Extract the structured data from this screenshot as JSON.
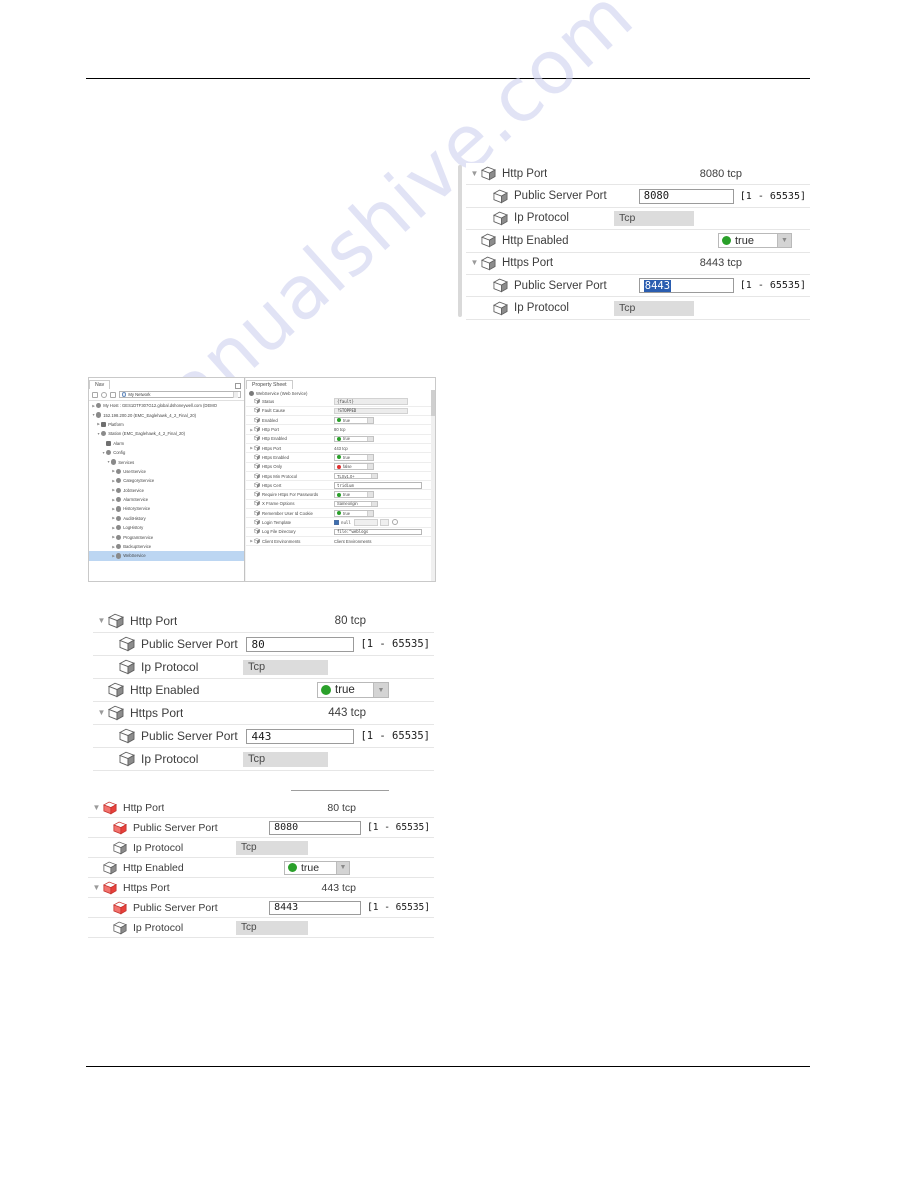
{
  "document": {
    "watermark": "manualshive.com",
    "header_rule": true,
    "footer_rule": true
  },
  "panel_top": {
    "name": "http-https-port-expanded-8080-8443",
    "rows": [
      {
        "twisty": "open",
        "indent": 0,
        "icon": "cube-icon",
        "icon_color": "#8c8c8c",
        "label": "Http Port",
        "value_type": "text",
        "value": "8080 tcp"
      },
      {
        "twisty": "blank",
        "indent": 1,
        "icon": "cube-icon",
        "icon_color": "#8c8c8c",
        "label": "Public Server Port",
        "value_type": "field",
        "value": "8080",
        "range": "[1 - 65535]",
        "selected": false
      },
      {
        "twisty": "blank",
        "indent": 1,
        "icon": "cube-icon",
        "icon_color": "#8c8c8c",
        "label": "Ip Protocol",
        "value_type": "disabled",
        "value": "Tcp"
      },
      {
        "twisty": "blank",
        "indent": 0,
        "icon": "cube-icon",
        "icon_color": "#8c8c8c",
        "label": "Http Enabled",
        "value_type": "combo",
        "value": "true",
        "dot": "green"
      },
      {
        "twisty": "open",
        "indent": 0,
        "icon": "cube-icon",
        "icon_color": "#8c8c8c",
        "label": "Https Port",
        "value_type": "text",
        "value": "8443 tcp"
      },
      {
        "twisty": "blank",
        "indent": 1,
        "icon": "cube-icon",
        "icon_color": "#8c8c8c",
        "label": "Public Server Port",
        "value_type": "field",
        "value": "8443",
        "range": "[1 - 65535]",
        "selected": true
      },
      {
        "twisty": "blank",
        "indent": 1,
        "icon": "cube-icon",
        "icon_color": "#8c8c8c",
        "label": "Ip Protocol",
        "value_type": "disabled",
        "value": "Tcp"
      }
    ]
  },
  "panel_workbench": {
    "nav": {
      "tab_label": "Nav",
      "address_value": "My Network",
      "address_icon": "globe-icon",
      "toolbar_icons": [
        "bookmark-icon",
        "refresh-icon",
        "stop-icon"
      ],
      "tree": [
        {
          "indent": 0,
          "twisty": "closed",
          "icon": "host-icon",
          "label": "My Host : GES1DTF307G12.global.dshoneywell.com (DEMO"
        },
        {
          "indent": 0,
          "twisty": "open",
          "icon": "station-icon",
          "label": "152.198.200.20 (EMC_Eaglehawk_4_2_Final_20)"
        },
        {
          "indent": 1,
          "twisty": "closed",
          "icon": "platform-icon",
          "label": "Platform"
        },
        {
          "indent": 1,
          "twisty": "open",
          "icon": "station-icon",
          "label": "Station (EMC_Eaglehawk_4_2_Final_20)"
        },
        {
          "indent": 2,
          "twisty": "blank",
          "icon": "alarm-icon",
          "label": "Alarm"
        },
        {
          "indent": 2,
          "twisty": "open",
          "icon": "config-icon",
          "label": "Config"
        },
        {
          "indent": 3,
          "twisty": "open",
          "icon": "services-icon",
          "label": "Services"
        },
        {
          "indent": 4,
          "twisty": "closed",
          "icon": "service-icon",
          "label": "UserService"
        },
        {
          "indent": 4,
          "twisty": "closed",
          "icon": "service-icon",
          "label": "CategoryService"
        },
        {
          "indent": 4,
          "twisty": "closed",
          "icon": "service-icon",
          "label": "JobService"
        },
        {
          "indent": 4,
          "twisty": "closed",
          "icon": "service-icon",
          "label": "AlarmService"
        },
        {
          "indent": 4,
          "twisty": "closed",
          "icon": "service-icon",
          "label": "HistoryService"
        },
        {
          "indent": 4,
          "twisty": "closed",
          "icon": "service-icon",
          "label": "AuditHistory"
        },
        {
          "indent": 4,
          "twisty": "closed",
          "icon": "service-icon",
          "label": "LogHistory"
        },
        {
          "indent": 4,
          "twisty": "closed",
          "icon": "service-icon",
          "label": "ProgramService"
        },
        {
          "indent": 4,
          "twisty": "closed",
          "icon": "service-icon",
          "label": "BackupService"
        },
        {
          "indent": 4,
          "twisty": "closed",
          "icon": "service-icon",
          "label": "WebService",
          "selected": true
        }
      ]
    },
    "property_sheet": {
      "tab_label": "Property Sheet",
      "object_title": "WebService  (Web Service)",
      "rows": [
        {
          "twisty": "blank",
          "label": "Status",
          "kind": "field",
          "value": "{fault}"
        },
        {
          "twisty": "blank",
          "label": "Fault Cause",
          "kind": "field",
          "value": "!STOPPED"
        },
        {
          "twisty": "blank",
          "label": "Enabled",
          "kind": "combo",
          "value": "true",
          "dot": "green"
        },
        {
          "twisty": "closed",
          "label": "Http Port",
          "kind": "text",
          "value": "80 tcp"
        },
        {
          "twisty": "blank",
          "label": "Http Enabled",
          "kind": "combo",
          "value": "true",
          "dot": "green"
        },
        {
          "twisty": "closed",
          "label": "Https Port",
          "kind": "text",
          "value": "443 tcp"
        },
        {
          "twisty": "blank",
          "label": "Https Enabled",
          "kind": "combo",
          "value": "true",
          "dot": "green"
        },
        {
          "twisty": "blank",
          "label": "Https Only",
          "kind": "combo",
          "value": "false",
          "dot": "red"
        },
        {
          "twisty": "blank",
          "label": "Https Min Protocol",
          "kind": "combo2",
          "value": "TLSv1.0+"
        },
        {
          "twisty": "blank",
          "label": "Https Cert",
          "kind": "fieldw",
          "value": "tridium"
        },
        {
          "twisty": "blank",
          "label": "Require Https For Passwords",
          "kind": "combo",
          "value": "true",
          "dot": "green"
        },
        {
          "twisty": "blank",
          "label": "X Frame Options",
          "kind": "combo2",
          "value": "Sameorigin"
        },
        {
          "twisty": "blank",
          "label": "Remember User Id Cookie",
          "kind": "combo",
          "value": "true",
          "dot": "green"
        },
        {
          "twisty": "blank",
          "label": "Login Template",
          "kind": "nullrow",
          "value": "null"
        },
        {
          "twisty": "blank",
          "label": "Log File Directory",
          "kind": "fieldw",
          "value": "file:^weblogs"
        },
        {
          "twisty": "closed",
          "label": "Client Environments",
          "kind": "text",
          "value": "Client Environments"
        }
      ]
    }
  },
  "panel_middle": {
    "name": "http-https-port-expanded-80-443",
    "rows": [
      {
        "twisty": "open",
        "indent": 0,
        "icon": "cube-icon",
        "icon_color": "#8c8c8c",
        "label": "Http Port",
        "value_type": "text",
        "value": "80 tcp"
      },
      {
        "twisty": "blank",
        "indent": 1,
        "icon": "cube-icon",
        "icon_color": "#8c8c8c",
        "label": "Public Server Port",
        "value_type": "field",
        "value": "80",
        "range": "[1 - 65535]"
      },
      {
        "twisty": "blank",
        "indent": 1,
        "icon": "cube-icon",
        "icon_color": "#8c8c8c",
        "label": "Ip Protocol",
        "value_type": "disabled",
        "value": "Tcp"
      },
      {
        "twisty": "blank",
        "indent": 0,
        "icon": "cube-icon",
        "icon_color": "#8c8c8c",
        "label": "Http Enabled",
        "value_type": "combo",
        "value": "true",
        "dot": "green"
      },
      {
        "twisty": "open",
        "indent": 0,
        "icon": "cube-icon",
        "icon_color": "#8c8c8c",
        "label": "Https Port",
        "value_type": "text",
        "value": "443 tcp"
      },
      {
        "twisty": "blank",
        "indent": 1,
        "icon": "cube-icon",
        "icon_color": "#8c8c8c",
        "label": "Public Server Port",
        "value_type": "field",
        "value": "443",
        "range": "[1 - 65535]"
      },
      {
        "twisty": "blank",
        "indent": 1,
        "icon": "cube-icon",
        "icon_color": "#8c8c8c",
        "label": "Ip Protocol",
        "value_type": "disabled",
        "value": "Tcp"
      }
    ]
  },
  "panel_bottom": {
    "name": "http-https-port-modified-8080-8443",
    "rows": [
      {
        "twisty": "open",
        "indent": 0,
        "icon": "cube-icon",
        "icon_color": "#e8413c",
        "label": "Http Port",
        "value_type": "text",
        "value": "80 tcp"
      },
      {
        "twisty": "blank",
        "indent": 1,
        "icon": "cube-icon",
        "icon_color": "#e8413c",
        "label": "Public Server Port",
        "value_type": "field",
        "value": "8080",
        "range": "[1 - 65535]"
      },
      {
        "twisty": "blank",
        "indent": 1,
        "icon": "cube-icon",
        "icon_color": "#8c8c8c",
        "label": "Ip Protocol",
        "value_type": "disabled",
        "value": "Tcp"
      },
      {
        "twisty": "blank",
        "indent": 0,
        "icon": "cube-icon",
        "icon_color": "#8c8c8c",
        "label": "Http Enabled",
        "value_type": "combo",
        "value": "true",
        "dot": "green"
      },
      {
        "twisty": "open",
        "indent": 0,
        "icon": "cube-icon",
        "icon_color": "#e8413c",
        "label": "Https Port",
        "value_type": "text",
        "value": "443 tcp"
      },
      {
        "twisty": "blank",
        "indent": 1,
        "icon": "cube-icon",
        "icon_color": "#e8413c",
        "label": "Public Server Port",
        "value_type": "field",
        "value": "8443",
        "range": "[1 - 65535]"
      },
      {
        "twisty": "blank",
        "indent": 1,
        "icon": "cube-icon",
        "icon_color": "#8c8c8c",
        "label": "Ip Protocol",
        "value_type": "disabled",
        "value": "Tcp"
      }
    ]
  },
  "colors": {
    "accent_green": "#2aa02a",
    "accent_red": "#e03030",
    "modified_icon": "#e8413c",
    "selection_blue": "#2a5db0",
    "tree_selection": "#bcd6f2"
  }
}
